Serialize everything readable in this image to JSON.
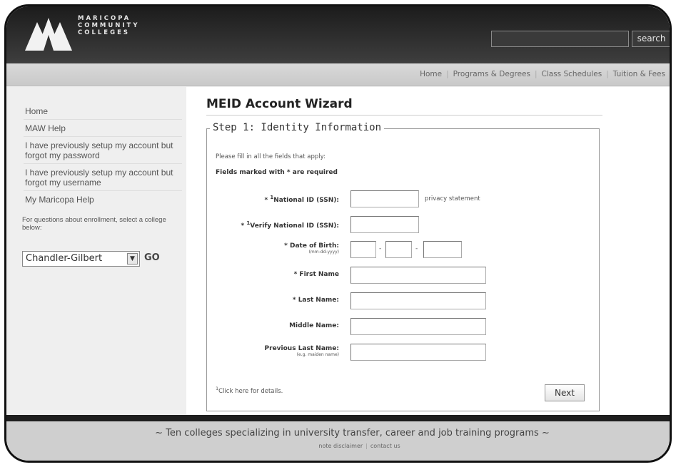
{
  "header": {
    "logo_lines": [
      "MARICOPA",
      "COMMUNITY",
      "COLLEGES"
    ],
    "search_placeholder": "",
    "search_label": "search"
  },
  "nav": {
    "links": [
      "Home",
      "Programs & Degrees",
      "Class Schedules",
      "Tuition & Fees"
    ]
  },
  "sidebar": {
    "items": [
      "Home",
      "MAW Help",
      "I have previously setup my account but forgot my password",
      "I have previously setup my account but forgot my username",
      "My Maricopa Help"
    ],
    "note": "For questions about enrollment, select a college below:",
    "college_selected": "Chandler-Gilbert",
    "go_label": "GO"
  },
  "main": {
    "title": "MEID Account Wizard",
    "step_legend": "Step 1: Identity Information",
    "instruction": "Please fill in all the fields that apply:",
    "required_note": "Fields marked with * are required",
    "fields": {
      "ssn": {
        "prefix": "* ",
        "sup": "1",
        "label": "National ID (SSN):"
      },
      "ssn_verify": {
        "prefix": "* ",
        "sup": "1",
        "label": "Verify National ID (SSN):"
      },
      "dob": {
        "label": "* Date of Birth:",
        "hint": "(mm-dd-yyyy)",
        "separator": "-"
      },
      "first_name": {
        "label": "* First Name"
      },
      "last_name": {
        "label": "* Last Name:"
      },
      "middle_name": {
        "label": "Middle Name:"
      },
      "previous_last_name": {
        "label": "Previous Last Name:",
        "hint": "(e.g. maiden name)"
      }
    },
    "privacy_link": "privacy statement",
    "footnote_sup": "1",
    "footnote": "Click here for details.",
    "next_label": "Next"
  },
  "footer": {
    "tagline": "~ Ten colleges specializing in university transfer, career and job training programs ~",
    "links": [
      "note disclaimer",
      "contact us"
    ]
  }
}
